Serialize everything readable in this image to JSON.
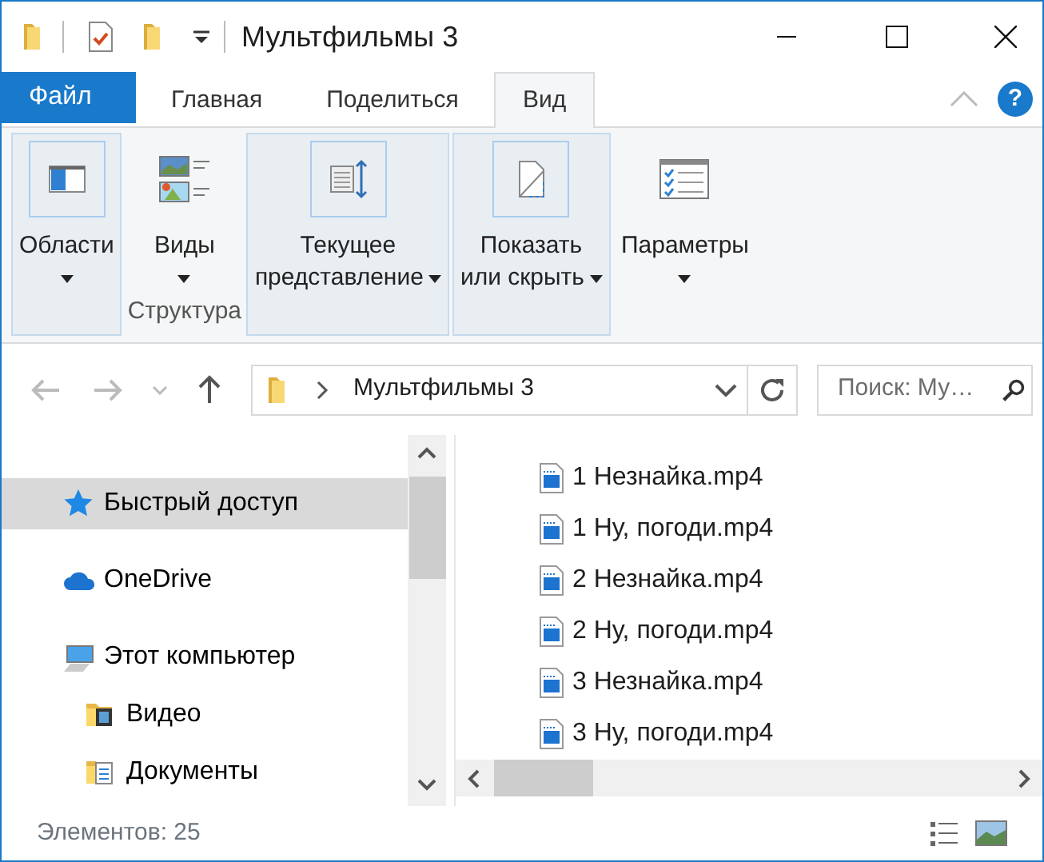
{
  "window": {
    "title": "Мультфильмы 3"
  },
  "tabs": [
    {
      "label": "Файл",
      "kind": "file",
      "selected": false
    },
    {
      "label": "Главная",
      "kind": "tab",
      "selected": false
    },
    {
      "label": "Поделиться",
      "kind": "tab",
      "selected": false
    },
    {
      "label": "Вид",
      "kind": "tab",
      "selected": true
    }
  ],
  "help_button": {
    "label": "?"
  },
  "ribbon": {
    "buttons": [
      {
        "label_lines": [
          "Области"
        ],
        "selected": true
      },
      {
        "label_lines": [
          "Виды"
        ],
        "selected": false,
        "group_label": "Структура"
      },
      {
        "label_lines": [
          "Текущее",
          "представление"
        ],
        "selected": true
      },
      {
        "label_lines": [
          "Показать",
          "или скрыть"
        ],
        "selected": true
      },
      {
        "label_lines": [
          "Параметры"
        ],
        "selected": false
      }
    ]
  },
  "address_bar": {
    "path": "Мультфильмы 3",
    "search": {
      "placeholder": "Поиск: Му…"
    }
  },
  "navigation_pane": {
    "items": [
      {
        "label": "Быстрый доступ",
        "selected": true
      },
      {
        "label": "OneDrive",
        "selected": false
      },
      {
        "label": "Этот компьютер",
        "selected": false,
        "children": [
          {
            "label": "Видео",
            "selected": false
          },
          {
            "label": "Документы",
            "selected": false
          }
        ]
      }
    ]
  },
  "files": [
    {
      "name": "1 Незнайка.mp4"
    },
    {
      "name": "1 Ну, погоди.mp4"
    },
    {
      "name": "2 Незнайка.mp4"
    },
    {
      "name": "2 Ну, погоди.mp4"
    },
    {
      "name": "3 Незнайка.mp4"
    },
    {
      "name": "3 Ну, погоди.mp4"
    }
  ],
  "status_bar": {
    "item_count": "Элементов: 25"
  }
}
